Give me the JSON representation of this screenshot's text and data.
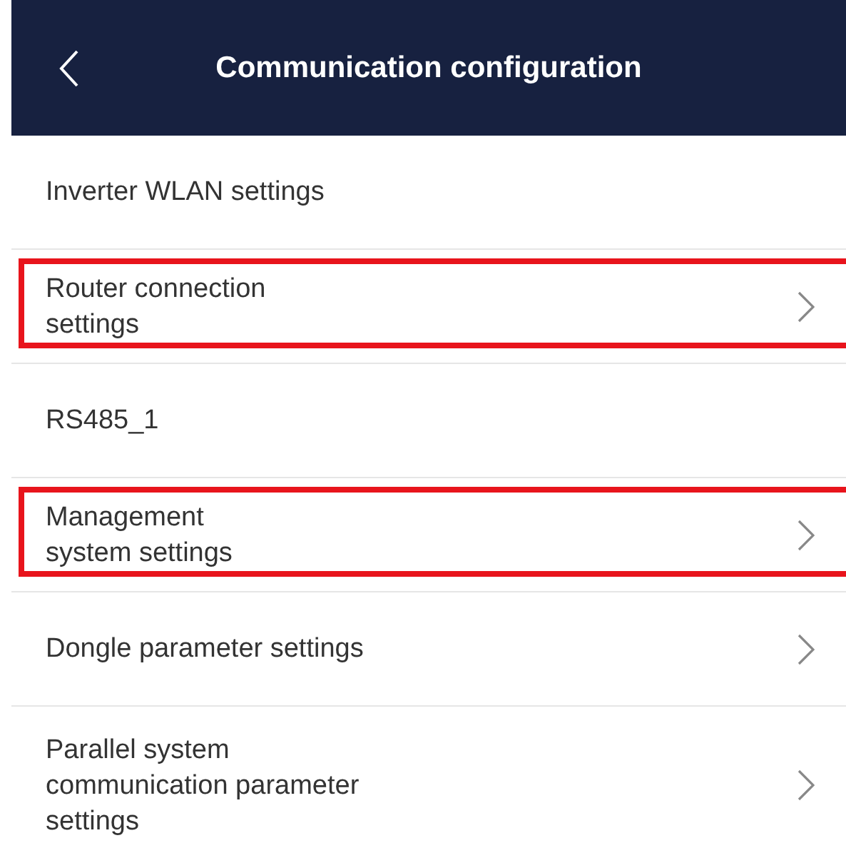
{
  "header": {
    "title": "Communication configuration"
  },
  "items": [
    {
      "label": "Inverter WLAN settings",
      "has_chevron": false,
      "highlighted": false
    },
    {
      "label": "Router connection\nsettings",
      "has_chevron": true,
      "highlighted": true
    },
    {
      "label": "RS485_1",
      "has_chevron": false,
      "highlighted": false
    },
    {
      "label": "Management\nsystem settings",
      "has_chevron": true,
      "highlighted": true
    },
    {
      "label": "Dongle parameter settings",
      "has_chevron": true,
      "highlighted": false
    },
    {
      "label": "Parallel system\ncommunication parameter\nsettings",
      "has_chevron": true,
      "highlighted": false
    }
  ]
}
